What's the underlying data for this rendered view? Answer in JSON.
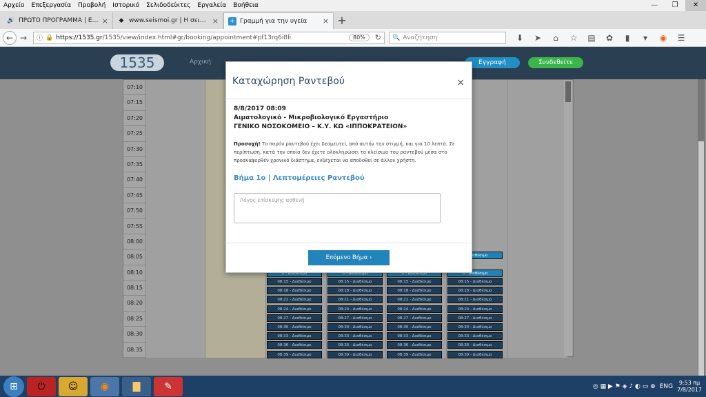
{
  "menu": [
    "Αρχείο",
    "Επεξεργασία",
    "Προβολή",
    "Ιστορικό",
    "Σελιδοδείκτες",
    "Εργαλεία",
    "Βοήθεια"
  ],
  "tabs": [
    {
      "title": "ΠΡΩΤΟ ΠΡΟΓΡΑΜΜΑ | ΕΡΤ",
      "icon": "radio-icon"
    },
    {
      "title": "www.seismoi.gr | Η σεισμικ",
      "icon": "seismoi-icon"
    },
    {
      "title": "Γραμμή για την υγεία",
      "icon": "health-cross-icon"
    }
  ],
  "nav": {
    "url_host": "https://1535.gr",
    "url_path": "/1535/view/index.html#gr/booking/appointment#pf13rq6i8li",
    "zoom": "80%",
    "search_placeholder": "Αναζήτηση"
  },
  "site": {
    "logo": "1535",
    "home": "Αρχική",
    "register": "Εγγραφή",
    "login": "Συνδεθείτε"
  },
  "times": [
    "07:10",
    "07:15",
    "07:20",
    "07:25",
    "07:30",
    "07:35",
    "07:40",
    "07:45",
    "07:50",
    "07:55",
    "08:00",
    "08:05",
    "08:10",
    "08:15",
    "08:20",
    "08:25",
    "08:30",
    "08:35"
  ],
  "slots": [
    "08:15 - Διαθέσιμο",
    "08:18 - Διαθέσιμο",
    "08:21 - Διαθέσιμο",
    "08:24 - Διαθέσιμο",
    "08:27 - Διαθέσιμο",
    "08:30 - Διαθέσιμο",
    "08:33 - Διαθέσιμο",
    "08:36 - Διαθέσιμο",
    "08:39 - Διαθέσιμο"
  ],
  "slot_partial": "ο - Διαθέσιμο",
  "modal": {
    "title": "Καταχώρηση Ραντεβού",
    "close": "×",
    "datetime": "8/8/2017 08:09",
    "lab": "Αιματολογικό - Μικροβιολογικό Εργαστήριο",
    "hospital": "ΓΕΝΙΚΟ ΝΟΣΟΚΟΜΕΙΟ – Κ.Υ. ΚΩ «ΙΠΠΟΚΡΑΤΕΙΟΝ»",
    "warn_label": "Προσοχή!",
    "warn_text": " Το παρόν ραντεβού έχει δεσμευτεί, από αυτήν την στιγμή, και για 10 λεπτά. Σε περίπτωση, κατά την οποία δεν έχετε ολοκληρώσει το κλείσιμο του ραντεβού μέσα στο προαναφερθέν χρονικό διάστημα, ενδέχεται να αποδοθεί σε άλλον χρήστη.",
    "step": "Βήμα 1ο | Λεπτομέρειες Ραντεβού",
    "reason_placeholder": "Λόγος επίσκεψης ασθενή",
    "next": "Επόμενο Βήμα ›"
  },
  "tray": {
    "lang": "ENG",
    "time": "9:53 πμ",
    "date": "7/8/2017"
  }
}
